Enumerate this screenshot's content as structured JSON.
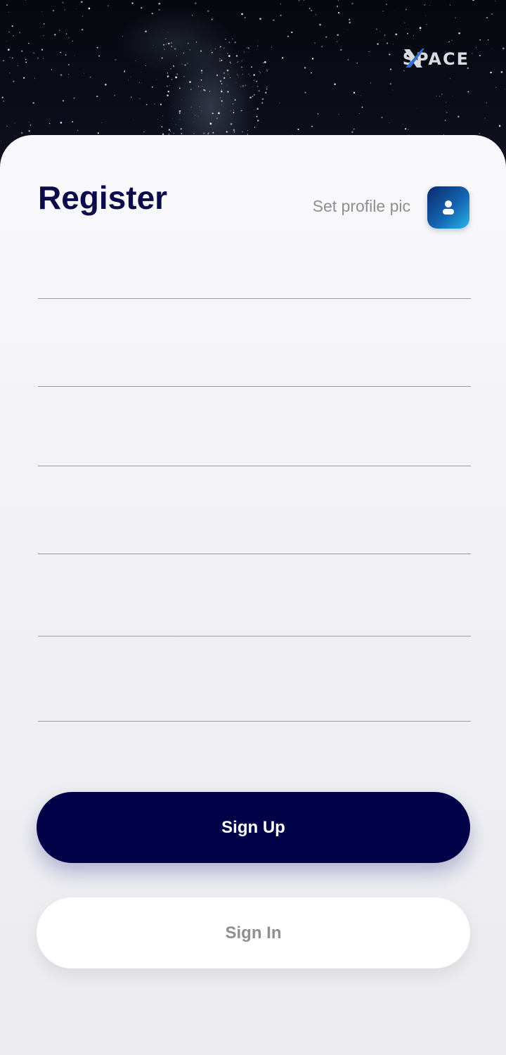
{
  "header": {
    "logo_text": "SPACE",
    "logo_mark": "X",
    "logo_icon": "spacex-logo"
  },
  "register": {
    "title": "Register",
    "profile_pic_label": "Set profile pic",
    "profile_pic_icon": "user-icon"
  },
  "form": {
    "fields": [
      {
        "value": ""
      },
      {
        "value": ""
      },
      {
        "value": ""
      },
      {
        "value": ""
      },
      {
        "value": ""
      },
      {
        "value": ""
      }
    ]
  },
  "actions": {
    "sign_up_label": "Sign Up",
    "sign_in_label": "Sign In"
  },
  "colors": {
    "title": "#0b0b4a",
    "primary_button": "#020248",
    "secondary_text": "#8e8e93",
    "profile_gradient_start": "#0b2a6c",
    "profile_gradient_end": "#27b6ea"
  }
}
